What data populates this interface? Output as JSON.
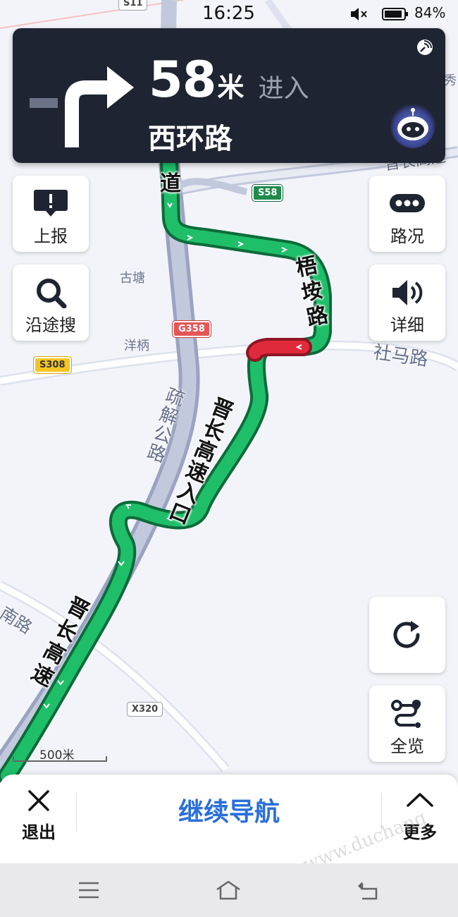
{
  "status_bar": {
    "time": "16:25",
    "battery": "84%"
  },
  "guidance": {
    "distance": "58",
    "unit": "米",
    "action": "进入",
    "road": "西环路",
    "turn_icon": "turn-right-arrow"
  },
  "side_buttons": {
    "report": {
      "label": "上报",
      "icon": "report-icon"
    },
    "search_along": {
      "label": "沿途搜",
      "icon": "search-icon"
    },
    "traffic": {
      "label": "路况",
      "icon": "traffic-icon"
    },
    "detail": {
      "label": "详细",
      "icon": "speaker-icon"
    },
    "refresh": {
      "icon": "refresh-icon"
    },
    "overview": {
      "label": "全览",
      "icon": "route-overview-icon"
    }
  },
  "map": {
    "places": [
      "古塘",
      "洋柄"
    ],
    "roads": {
      "r1": "道",
      "r2": "梧 垵 路",
      "r3": "晋长高速入口",
      "r4": "疏解公路",
      "r5": "晋长高速",
      "r6": "社马路",
      "r7": "晋长高速",
      "r8": "南路",
      "r9": "秀"
    },
    "shields": {
      "s58": "S58",
      "g358": "G358",
      "s308": "S308",
      "x320": "X320",
      "s11": "S11"
    },
    "scale": "500米"
  },
  "bottom_bar": {
    "exit": "退出",
    "continue": "继续导航",
    "more": "更多"
  },
  "watermark": "www.duchang",
  "colors": {
    "route": "#1fbf6a",
    "congestion": "#e02a3c",
    "card": "#1e2431",
    "accent": "#2a6fdc"
  }
}
